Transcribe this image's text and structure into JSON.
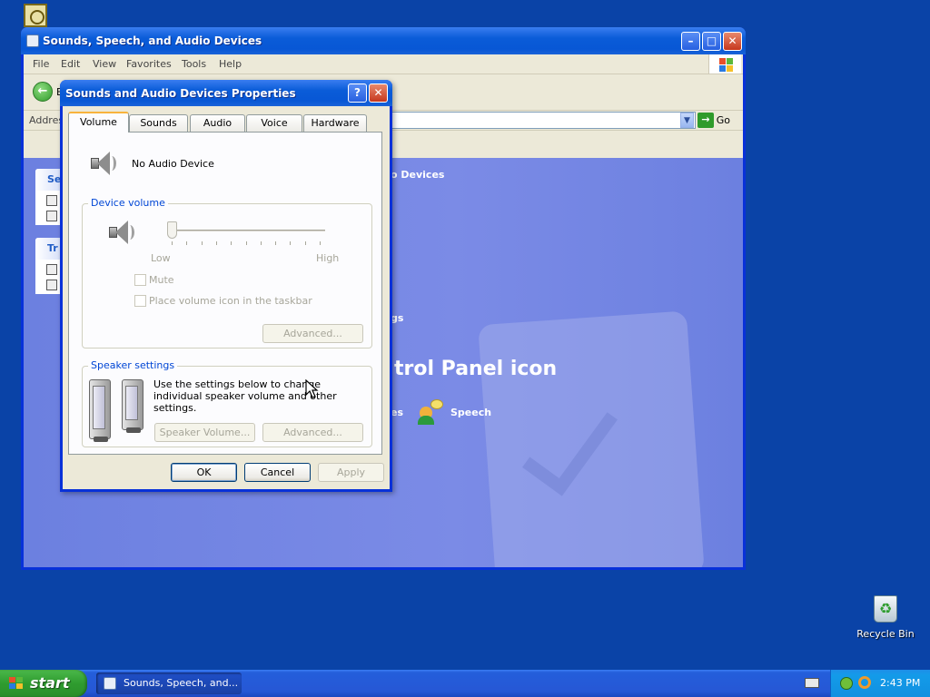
{
  "explorer": {
    "title": "Sounds, Speech, and Audio Devices",
    "menu": [
      "File",
      "Edit",
      "View",
      "Favorites",
      "Tools",
      "Help"
    ],
    "toolbar": {
      "back_label": "B"
    },
    "address": {
      "label": "Address",
      "go_label": "Go"
    },
    "content": {
      "heading_fragment": "o Devices",
      "link_fragment_1": "gs",
      "section_fragment": "trol Panel icon",
      "link_fragment_2": "es",
      "speech_label": "Speech",
      "sidebar_box_1_hdr": "Se",
      "sidebar_box_2_hdr": "Tr"
    }
  },
  "dialog": {
    "title": "Sounds and Audio Devices Properties",
    "tabs": [
      "Volume",
      "Sounds",
      "Audio",
      "Voice",
      "Hardware"
    ],
    "active_tab": "Volume",
    "device_name": "No Audio Device",
    "device_volume": {
      "title": "Device volume",
      "low_label": "Low",
      "high_label": "High",
      "level": 0,
      "mute_label": "Mute",
      "taskbar_icon_label": "Place volume icon in the taskbar",
      "advanced_label": "Advanced..."
    },
    "speaker_settings": {
      "title": "Speaker settings",
      "description": "Use the settings below to change individual speaker volume and other settings.",
      "speaker_volume_label": "Speaker Volume...",
      "advanced_label": "Advanced..."
    },
    "buttons": {
      "ok": "OK",
      "cancel": "Cancel",
      "apply": "Apply"
    }
  },
  "desktop": {
    "recycle_bin_label": "Recycle Bin"
  },
  "taskbar": {
    "start_label": "start",
    "task_item": "Sounds, Speech, and...",
    "clock": "2:43 PM"
  },
  "colors": {
    "desktop": "#0a43a7",
    "title_bar": "#0a5cd8",
    "control_panel_bg": "#7b8be6",
    "group_title": "#0046d5",
    "start_button": "#2f9c2f",
    "tray": "#139be9"
  }
}
